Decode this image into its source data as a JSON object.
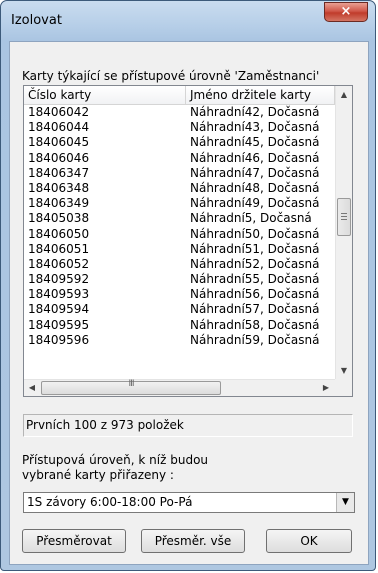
{
  "window": {
    "title": "Izolovat",
    "close_glyph": "×"
  },
  "list_label": "Karty týkající se přístupové úrovně 'Zaměstnanci'",
  "columns": {
    "card_number": "Číslo karty",
    "holder_name": "Jméno držitele karty"
  },
  "rows": [
    {
      "card": "18406042",
      "name": "Náhradní42, Dočasná"
    },
    {
      "card": "18406044",
      "name": "Náhradní43, Dočasná"
    },
    {
      "card": "18406045",
      "name": "Náhradní45, Dočasná"
    },
    {
      "card": "18406046",
      "name": "Náhradní46, Dočasná"
    },
    {
      "card": "18406347",
      "name": "Náhradní47, Dočasná"
    },
    {
      "card": "18406348",
      "name": "Náhradní48, Dočasná"
    },
    {
      "card": "18406349",
      "name": "Náhradní49, Dočasná"
    },
    {
      "card": "18405038",
      "name": "Náhradní5, Dočasná"
    },
    {
      "card": "18406050",
      "name": "Náhradní50, Dočasná"
    },
    {
      "card": "18406051",
      "name": "Náhradní51, Dočasná"
    },
    {
      "card": "18406052",
      "name": "Náhradní52, Dočasná"
    },
    {
      "card": "18409592",
      "name": "Náhradní55, Dočasná"
    },
    {
      "card": "18409593",
      "name": "Náhradní56, Dočasná"
    },
    {
      "card": "18409594",
      "name": "Náhradní57, Dočasná"
    },
    {
      "card": "18409595",
      "name": "Náhradní58, Dočasná"
    },
    {
      "card": "18409596",
      "name": "Náhradní59, Dočasná"
    }
  ],
  "scroll": {
    "up": "▲",
    "down": "▼",
    "left": "◀",
    "right": "▶",
    "grip": "III"
  },
  "status_text": "Prvních 100 z 973 položek",
  "target_label_line1": "Přístupová úroveň, k níž budou",
  "target_label_line2": "vybrané karty přiřazeny :",
  "access_level_value": "1S závory 6:00-18:00 Po-Pá",
  "dropdown_glyph": "▼",
  "buttons": {
    "redirect": "Přesměrovat",
    "redirect_all": "Přesměr. vše",
    "ok": "OK"
  }
}
